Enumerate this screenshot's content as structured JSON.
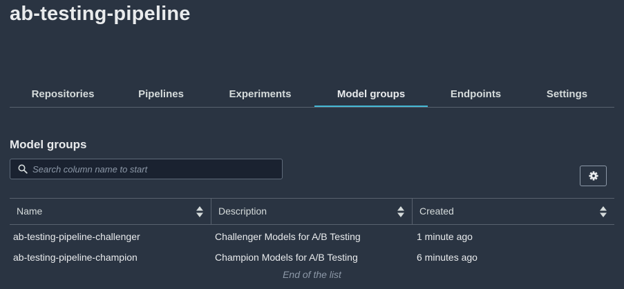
{
  "page": {
    "title": "ab-testing-pipeline"
  },
  "tabs": [
    {
      "label": "Repositories",
      "active": false
    },
    {
      "label": "Pipelines",
      "active": false
    },
    {
      "label": "Experiments",
      "active": false
    },
    {
      "label": "Model groups",
      "active": true
    },
    {
      "label": "Endpoints",
      "active": false
    },
    {
      "label": "Settings",
      "active": false
    }
  ],
  "section": {
    "title": "Model groups"
  },
  "search": {
    "placeholder": "Search column name to start",
    "value": "",
    "icon": "search-icon"
  },
  "settings_button": {
    "icon": "gear-icon"
  },
  "table": {
    "columns": [
      {
        "label": "Name",
        "icon": "sort-icon"
      },
      {
        "label": "Description",
        "icon": "sort-icon"
      },
      {
        "label": "Created",
        "icon": "sort-icon"
      }
    ],
    "rows": [
      {
        "name": "ab-testing-pipeline-challenger",
        "description": "Challenger Models for A/B Testing",
        "created": "1 minute ago"
      },
      {
        "name": "ab-testing-pipeline-champion",
        "description": "Champion Models for A/B Testing",
        "created": "6 minutes ago"
      }
    ],
    "end_text": "End of the list"
  },
  "colors": {
    "background": "#2a3442",
    "accent": "#44b9d6",
    "border": "#59626f"
  }
}
